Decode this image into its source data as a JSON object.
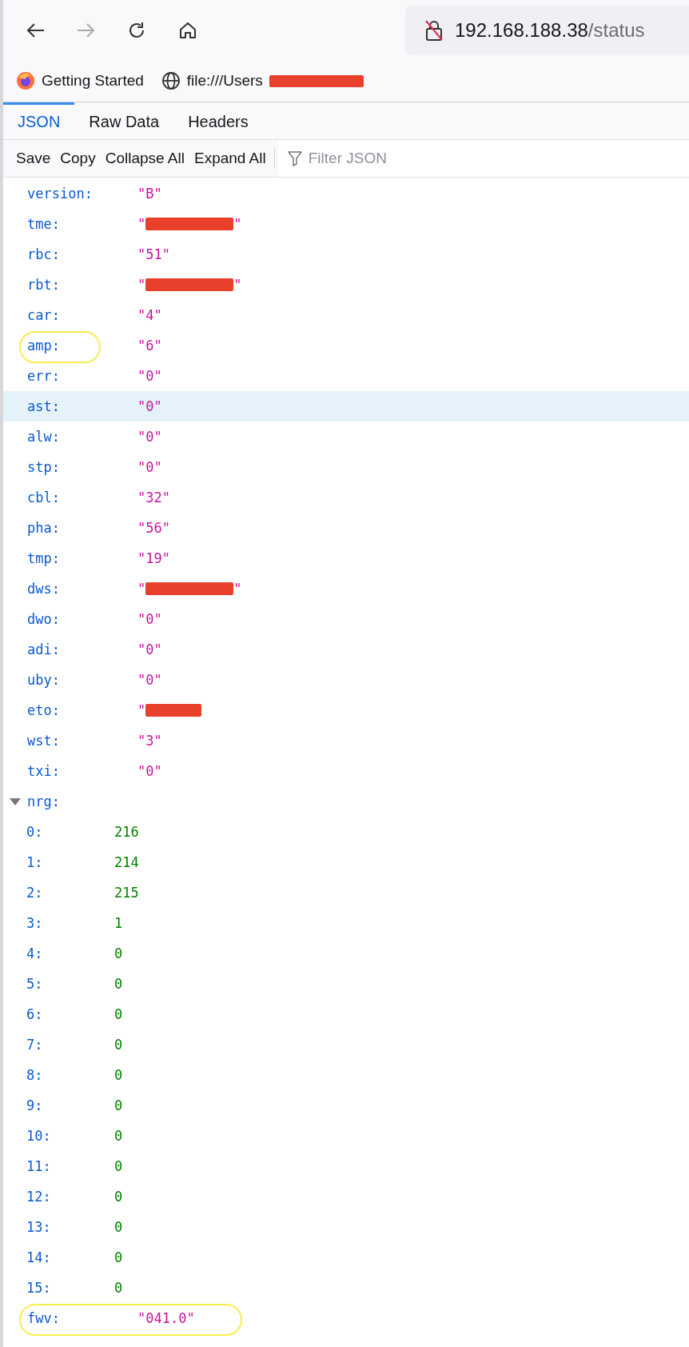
{
  "toolbar": {
    "url_host": "192.168.188.38",
    "url_path": "/status"
  },
  "bookmarks": [
    {
      "kind": "firefox",
      "label": "Getting Started",
      "redacted": false
    },
    {
      "kind": "globe",
      "label": "file:///Users",
      "redacted": true
    }
  ],
  "tabs": [
    {
      "label": "JSON",
      "selected": true
    },
    {
      "label": "Raw Data",
      "selected": false
    },
    {
      "label": "Headers",
      "selected": false
    }
  ],
  "actions": [
    "Save",
    "Copy",
    "Collapse All",
    "Expand All"
  ],
  "filter": {
    "placeholder": "Filter JSON"
  },
  "rows": [
    {
      "key": "version:",
      "value": "\"B\"",
      "kind": "string",
      "hovered": false,
      "circled": false
    },
    {
      "key": "tme:",
      "open": "\"",
      "close": "\"",
      "kind": "redacted",
      "hovered": false,
      "circled": false
    },
    {
      "key": "rbc:",
      "value": "\"51\"",
      "kind": "string",
      "hovered": false,
      "circled": false
    },
    {
      "key": "rbt:",
      "open": "\"",
      "close": "\"",
      "kind": "redacted",
      "hovered": false,
      "circled": false
    },
    {
      "key": "car:",
      "value": "\"4\"",
      "kind": "string",
      "hovered": false,
      "circled": false
    },
    {
      "key": "amp:",
      "value": "\"6\"",
      "kind": "string",
      "hovered": false,
      "circled": true
    },
    {
      "key": "err:",
      "value": "\"0\"",
      "kind": "string",
      "hovered": false,
      "circled": false
    },
    {
      "key": "ast:",
      "value": "\"0\"",
      "kind": "string",
      "hovered": true,
      "circled": false
    },
    {
      "key": "alw:",
      "value": "\"0\"",
      "kind": "string",
      "hovered": false,
      "circled": false
    },
    {
      "key": "stp:",
      "value": "\"0\"",
      "kind": "string",
      "hovered": false,
      "circled": false
    },
    {
      "key": "cbl:",
      "value": "\"32\"",
      "kind": "string",
      "hovered": false,
      "circled": false
    },
    {
      "key": "pha:",
      "value": "\"56\"",
      "kind": "string",
      "hovered": false,
      "circled": false
    },
    {
      "key": "tmp:",
      "value": "\"19\"",
      "kind": "string",
      "hovered": false,
      "circled": false
    },
    {
      "key": "dws:",
      "open": "\"",
      "close": "\"",
      "kind": "redacted",
      "hovered": false,
      "circled": false
    },
    {
      "key": "dwo:",
      "value": "\"0\"",
      "kind": "string",
      "hovered": false,
      "circled": false
    },
    {
      "key": "adi:",
      "value": "\"0\"",
      "kind": "string",
      "hovered": false,
      "circled": false
    },
    {
      "key": "uby:",
      "value": "\"0\"",
      "kind": "string",
      "hovered": false,
      "circled": false
    },
    {
      "key": "eto:",
      "open": "\"",
      "kind": "redacted",
      "hovered": false,
      "circled": false
    },
    {
      "key": "wst:",
      "value": "\"3\"",
      "kind": "string",
      "hovered": false,
      "circled": false
    },
    {
      "key": "txi:",
      "value": "\"0\"",
      "kind": "string",
      "hovered": false,
      "circled": false
    },
    {
      "key": "nrg:",
      "kind": "array",
      "expanded": true,
      "hovered": false,
      "circled": false,
      "children": [
        {
          "key": "0:",
          "value": "216",
          "kind": "number"
        },
        {
          "key": "1:",
          "value": "214",
          "kind": "number"
        },
        {
          "key": "2:",
          "value": "215",
          "kind": "number"
        },
        {
          "key": "3:",
          "value": "1",
          "kind": "number"
        },
        {
          "key": "4:",
          "value": "0",
          "kind": "number"
        },
        {
          "key": "5:",
          "value": "0",
          "kind": "number"
        },
        {
          "key": "6:",
          "value": "0",
          "kind": "number"
        },
        {
          "key": "7:",
          "value": "0",
          "kind": "number"
        },
        {
          "key": "8:",
          "value": "0",
          "kind": "number"
        },
        {
          "key": "9:",
          "value": "0",
          "kind": "number"
        },
        {
          "key": "10:",
          "value": "0",
          "kind": "number"
        },
        {
          "key": "11:",
          "value": "0",
          "kind": "number"
        },
        {
          "key": "12:",
          "value": "0",
          "kind": "number"
        },
        {
          "key": "13:",
          "value": "0",
          "kind": "number"
        },
        {
          "key": "14:",
          "value": "0",
          "kind": "number"
        },
        {
          "key": "15:",
          "value": "0",
          "kind": "number"
        }
      ]
    },
    {
      "key": "fwv:",
      "value": "\"041.0\"",
      "kind": "string",
      "hovered": false,
      "circled": true
    }
  ]
}
